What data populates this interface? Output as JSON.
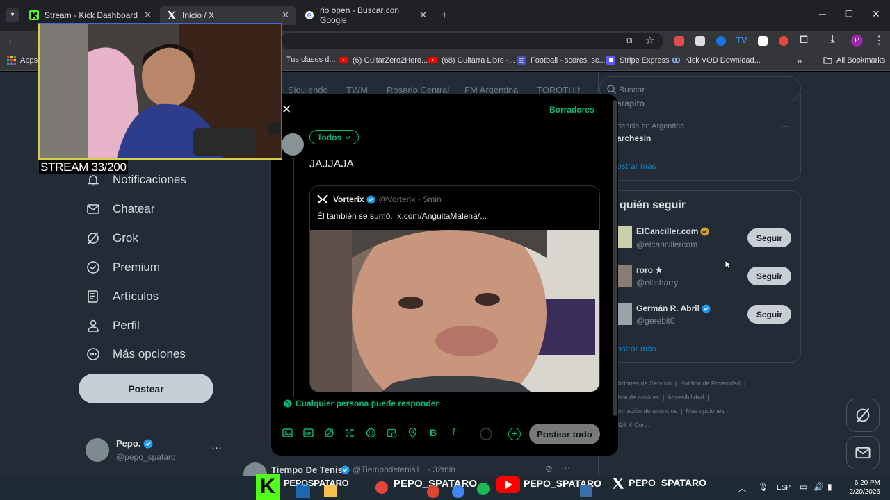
{
  "browser": {
    "tabs": [
      {
        "title": "Stream - Kick Dashboard"
      },
      {
        "title": "Inicio / X"
      },
      {
        "title": "rio open - Buscar con Google"
      }
    ],
    "bookmarks": [
      {
        "label": "Apps"
      },
      {
        "label": "Tus clases d..."
      },
      {
        "label": "(6) GuitarZero2Hero..."
      },
      {
        "label": "(68) Guitarra Libre -..."
      },
      {
        "label": "Football - scores, sc..."
      },
      {
        "label": "Stripe Express"
      },
      {
        "label": "Kick VOD Download..."
      }
    ],
    "all_bookmarks": "All Bookmarks",
    "more": "»"
  },
  "overlay": {
    "stream_counter": "STREAM 33/200"
  },
  "sidebar": {
    "items": [
      {
        "label": "Notificaciones",
        "icon": "bell-icon"
      },
      {
        "label": "Chatear",
        "icon": "mail-icon"
      },
      {
        "label": "Grok",
        "icon": "grok-icon"
      },
      {
        "label": "Premium",
        "icon": "verified-icon"
      },
      {
        "label": "Artículos",
        "icon": "article-icon"
      },
      {
        "label": "Perfil",
        "icon": "person-icon"
      },
      {
        "label": "Más opciones",
        "icon": "more-circle-icon"
      }
    ],
    "post_button": "Postear",
    "account": {
      "name": "Pepo.",
      "handle": "@pepo_spataro"
    }
  },
  "top_tabs": [
    "Siguiendo",
    "TWM",
    "Rosario Central",
    "FM Argentina",
    "TOROTHIN"
  ],
  "search": {
    "placeholder": "Buscar"
  },
  "trends": {
    "partial_top": "arapito",
    "trend_context": "dencia en Argentina",
    "trend_name": "archesín",
    "show_more": "ostrar más"
  },
  "who_to_follow": {
    "title": "quién seguir",
    "accounts": [
      {
        "name": "ElCanciller.com",
        "handle": "@elcancillercom",
        "badge": "gold"
      },
      {
        "name": "roro ★",
        "handle": "@eilisharry",
        "badge": "none"
      },
      {
        "name": "Germán R. Abril",
        "handle": "@gerebit0",
        "badge": "blue"
      }
    ],
    "follow_label": "Seguir",
    "show_more": "ostrar más"
  },
  "footer": {
    "links": [
      "diciones de Servicio",
      "Política de Privacidad",
      "ítica de cookies",
      "Accesibilidad",
      "ormación de anuncios",
      "Más opciones ···"
    ],
    "copyright": "026 X Corp."
  },
  "feed_bottom": {
    "name": "Tiempo De Tenis",
    "handle": "@Tiempodetenis1",
    "time": "· 32min"
  },
  "composer": {
    "drafts": "Borradores",
    "audience": "Todos",
    "text": "JAJJAJA",
    "quoted": {
      "name": "Vorterix",
      "handle": "@Vorterix",
      "time": "· 5min",
      "text": "Él también se sumó.  x.com/AnguitaMalena/..."
    },
    "reply_setting": "Cualquier persona puede responder",
    "post_all": "Postear todo"
  },
  "taskbar": {
    "lang": "ESP",
    "time": "6:20 PM",
    "date": "2/20/2026",
    "watermarks": [
      "PEPOSPATARO",
      "PEPO_SPATARO",
      "PEPO_SPATARO",
      "PEPO_SPATARO"
    ]
  },
  "colors": {
    "accent_green": "#00ba7c",
    "kick_green": "#53fc18",
    "x_blue": "#1d9bf0",
    "webcam_border": "#4169e1"
  }
}
